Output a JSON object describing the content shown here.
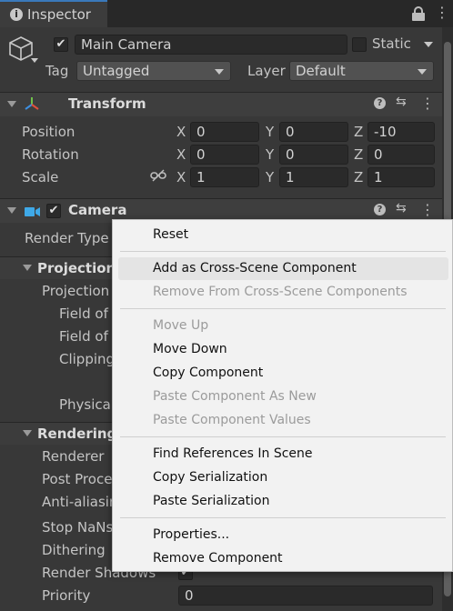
{
  "tab": {
    "title": "Inspector"
  },
  "object": {
    "name": "Main Camera",
    "static_label": "Static",
    "tag_label": "Tag",
    "tag_value": "Untagged",
    "layer_label": "Layer",
    "layer_value": "Default"
  },
  "transform": {
    "title": "Transform",
    "position": {
      "label": "Position",
      "x": "0",
      "y": "0",
      "z": "-10"
    },
    "rotation": {
      "label": "Rotation",
      "x": "0",
      "y": "0",
      "z": "0"
    },
    "scale": {
      "label": "Scale",
      "x": "1",
      "y": "1",
      "z": "1"
    },
    "axes": {
      "x": "X",
      "y": "Y",
      "z": "Z"
    }
  },
  "camera": {
    "title": "Camera",
    "render_type": "Render Type",
    "projection_header": "Projection",
    "projection": "Projection",
    "field_of_1": "Field of",
    "field_of_2": "Field of",
    "clipping": "Clipping",
    "physical": "Physica",
    "rendering_header": "Rendering",
    "renderer": "Renderer",
    "post_process": "Post Proce",
    "anti_aliasing": "Anti-aliasir",
    "stop_nans": "Stop NaNs",
    "dithering": "Dithering",
    "render_shadows": "Render Shadows",
    "priority": "Priority",
    "priority_value": "0"
  },
  "menu": {
    "items": [
      {
        "label": "Reset",
        "disabled": false
      },
      {
        "label": "Add as Cross-Scene Component",
        "disabled": false
      },
      {
        "label": "Remove From Cross-Scene Components",
        "disabled": true
      },
      {
        "label": "Move Up",
        "disabled": true
      },
      {
        "label": "Move Down",
        "disabled": false
      },
      {
        "label": "Copy Component",
        "disabled": false
      },
      {
        "label": "Paste Component As New",
        "disabled": true
      },
      {
        "label": "Paste Component Values",
        "disabled": true
      },
      {
        "label": "Find References In Scene",
        "disabled": false
      },
      {
        "label": "Copy Serialization",
        "disabled": false
      },
      {
        "label": "Paste Serialization",
        "disabled": false
      },
      {
        "label": "Properties...",
        "disabled": false
      },
      {
        "label": "Remove Component",
        "disabled": false
      }
    ]
  },
  "icons": {
    "info": "info-icon",
    "lock": "lock-icon",
    "more": "kebab-menu-icon",
    "help": "help-icon",
    "preset": "preset-icon",
    "gameobject": "cube-icon",
    "transform": "transform-gizmo-icon",
    "camera": "camera-icon",
    "link": "link-broken-icon"
  }
}
